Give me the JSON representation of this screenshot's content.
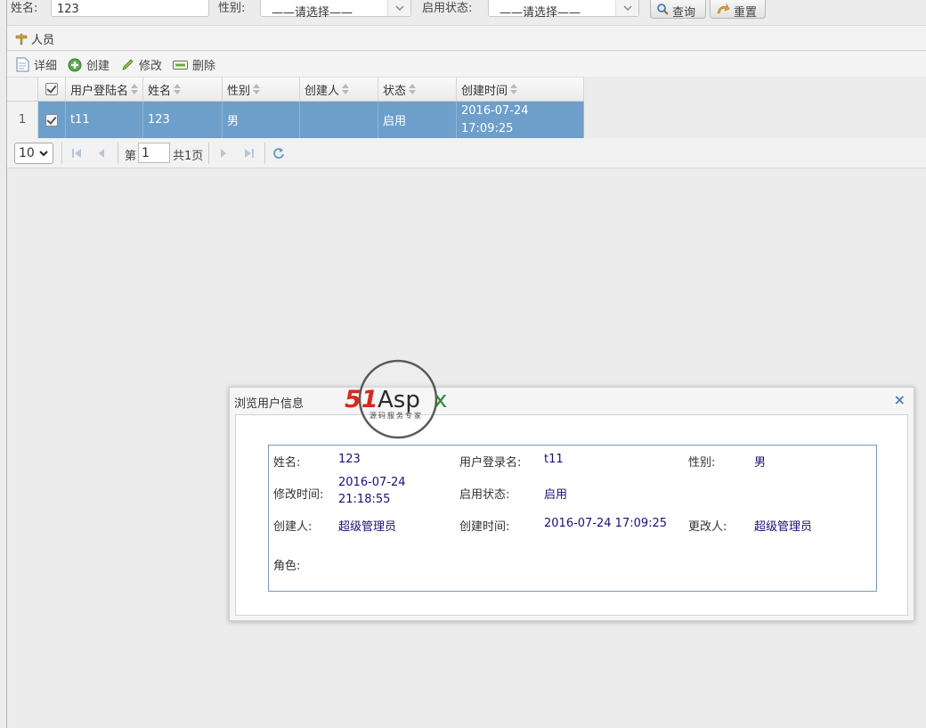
{
  "search": {
    "name_label": "姓名:",
    "name_value": "123",
    "gender_label": "性别:",
    "gender_selected": "——请选择——",
    "status_label": "启用状态:",
    "status_selected": "——请选择——",
    "query_button": "查询",
    "reset_button": "重置"
  },
  "panel": {
    "title": "人员"
  },
  "toolbar": {
    "detail": "详细",
    "create": "创建",
    "edit": "修改",
    "delete": "删除"
  },
  "grid": {
    "columns": [
      "用户登陆名",
      "姓名",
      "性别",
      "创建人",
      "状态",
      "创建时间"
    ],
    "rows": [
      {
        "index": "1",
        "login": "t11",
        "name": "123",
        "gender": "男",
        "creator": "",
        "status": "启用",
        "created_date": "2016-07-24",
        "created_time": "17:09:25"
      }
    ]
  },
  "pager": {
    "page_size": "10",
    "page_prefix": "第",
    "page_value": "1",
    "page_total": "共1页"
  },
  "dialog": {
    "title": "浏览用户信息",
    "close": "×",
    "fields": {
      "name_label": "姓名:",
      "name_value": "123",
      "login_label": "用户登录名:",
      "login_value": "t11",
      "gender_label": "性别:",
      "gender_value": "男",
      "modified_label": "修改时间:",
      "modified_date": "2016-07-24",
      "modified_time": "21:18:55",
      "status_label": "启用状态:",
      "status_value": "启用",
      "creator_label": "创建人:",
      "creator_value": "超级管理员",
      "created_label": "创建时间:",
      "created_value": "2016-07-24 17:09:25",
      "updater_label": "更改人:",
      "updater_value": "超级管理员",
      "role_label": "角色:"
    }
  },
  "watermark": {
    "brand": "51Aspx",
    "tagline": "源码服务专家"
  },
  "colors": {
    "selected_row": "#6e9fcb",
    "accent_link": "#1a0f7a",
    "logo_red": "#d9281e",
    "logo_green": "#2e8b3a"
  }
}
